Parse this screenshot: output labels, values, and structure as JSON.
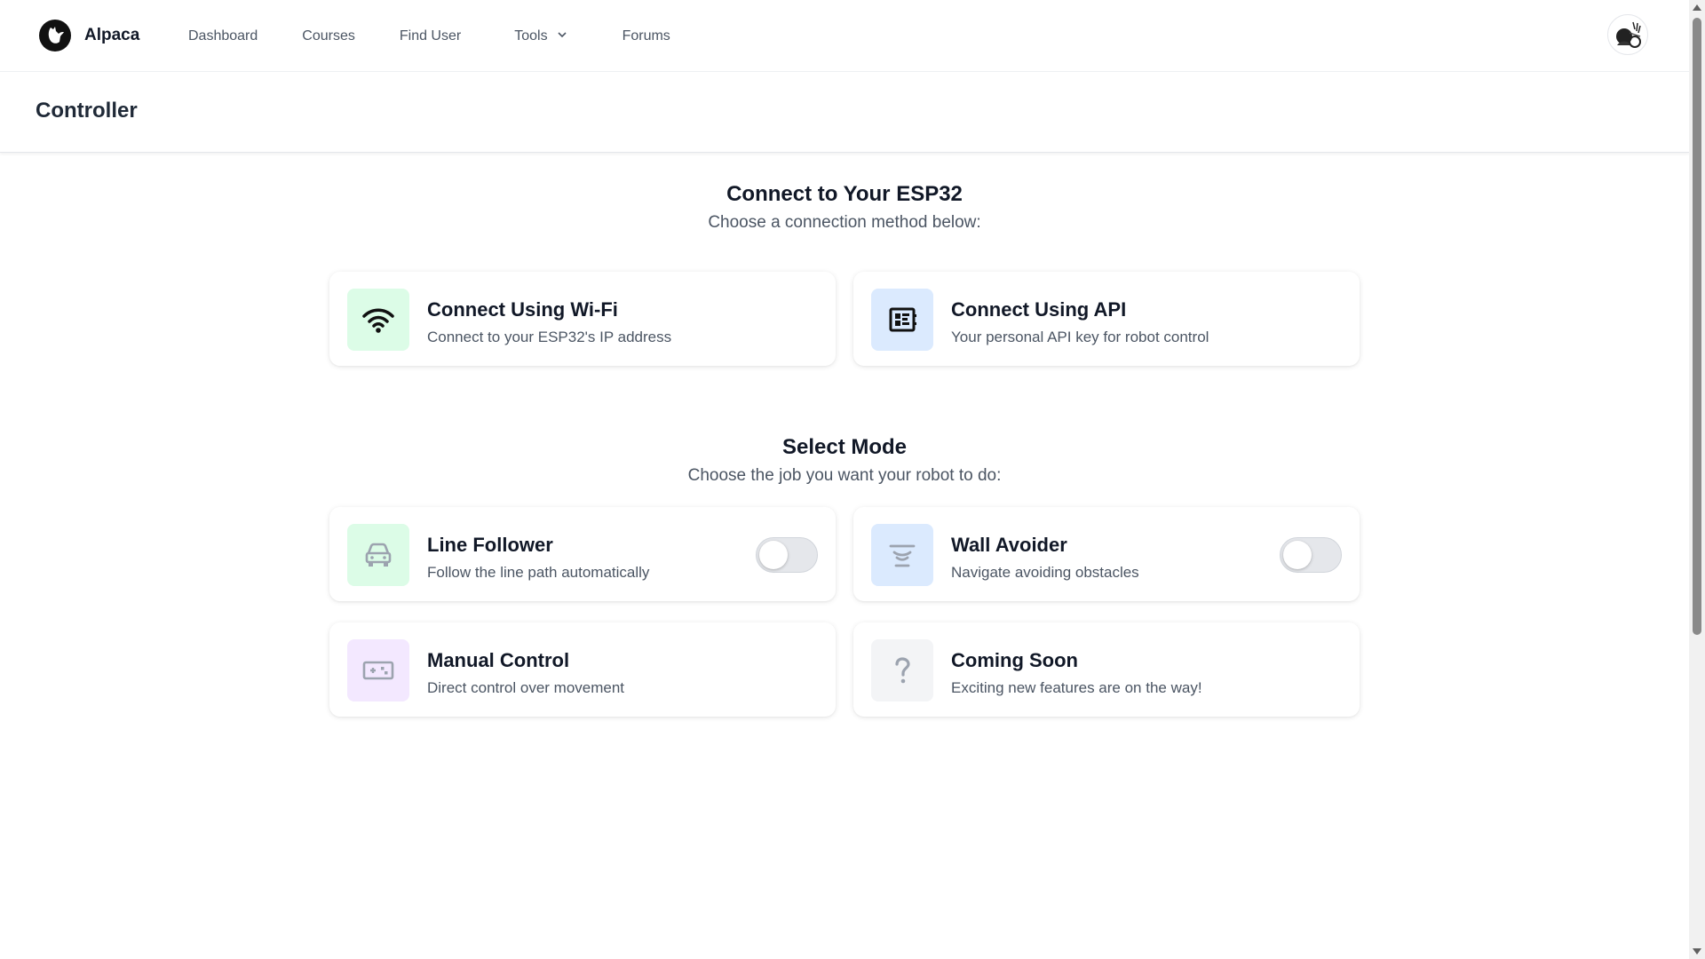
{
  "brand": {
    "name": "Alpaca"
  },
  "nav": {
    "links": [
      {
        "label": "Dashboard"
      },
      {
        "label": "Courses"
      },
      {
        "label": "Find User"
      },
      {
        "label": "Tools"
      },
      {
        "label": "Forums"
      }
    ]
  },
  "page": {
    "title": "Controller"
  },
  "connect": {
    "title": "Connect to Your ESP32",
    "subtitle": "Choose a connection method below:",
    "cards": [
      {
        "title": "Connect Using Wi-Fi",
        "desc": "Connect to your ESP32's IP address",
        "icon": "wifi-icon",
        "icon_bg": "#dcfce7",
        "icon_color": "#111111"
      },
      {
        "title": "Connect Using API",
        "desc": "Your personal API key for robot control",
        "icon": "api-chip-icon",
        "icon_bg": "#dbeafe",
        "icon_color": "#111111"
      }
    ]
  },
  "mode": {
    "title": "Select Mode",
    "subtitle": "Choose the job you want your robot to do:",
    "cards": [
      {
        "title": "Line Follower",
        "desc": "Follow the line path automatically",
        "icon": "car-icon",
        "icon_bg": "#dcfce7",
        "icon_color": "#9ca3af",
        "toggle_on": false
      },
      {
        "title": "Wall Avoider",
        "desc": "Navigate avoiding obstacles",
        "icon": "sensor-icon",
        "icon_bg": "#dbeafe",
        "icon_color": "#9ca3af",
        "toggle_on": false
      },
      {
        "title": "Manual Control",
        "desc": "Direct control over movement",
        "icon": "gamepad-icon",
        "icon_bg": "#f3e8ff",
        "icon_color": "#9ca3af"
      },
      {
        "title": "Coming Soon",
        "desc": "Exciting new features are on the way!",
        "icon": "question-icon",
        "icon_bg": "#f3f4f6",
        "icon_color": "#9ca3af"
      }
    ]
  }
}
